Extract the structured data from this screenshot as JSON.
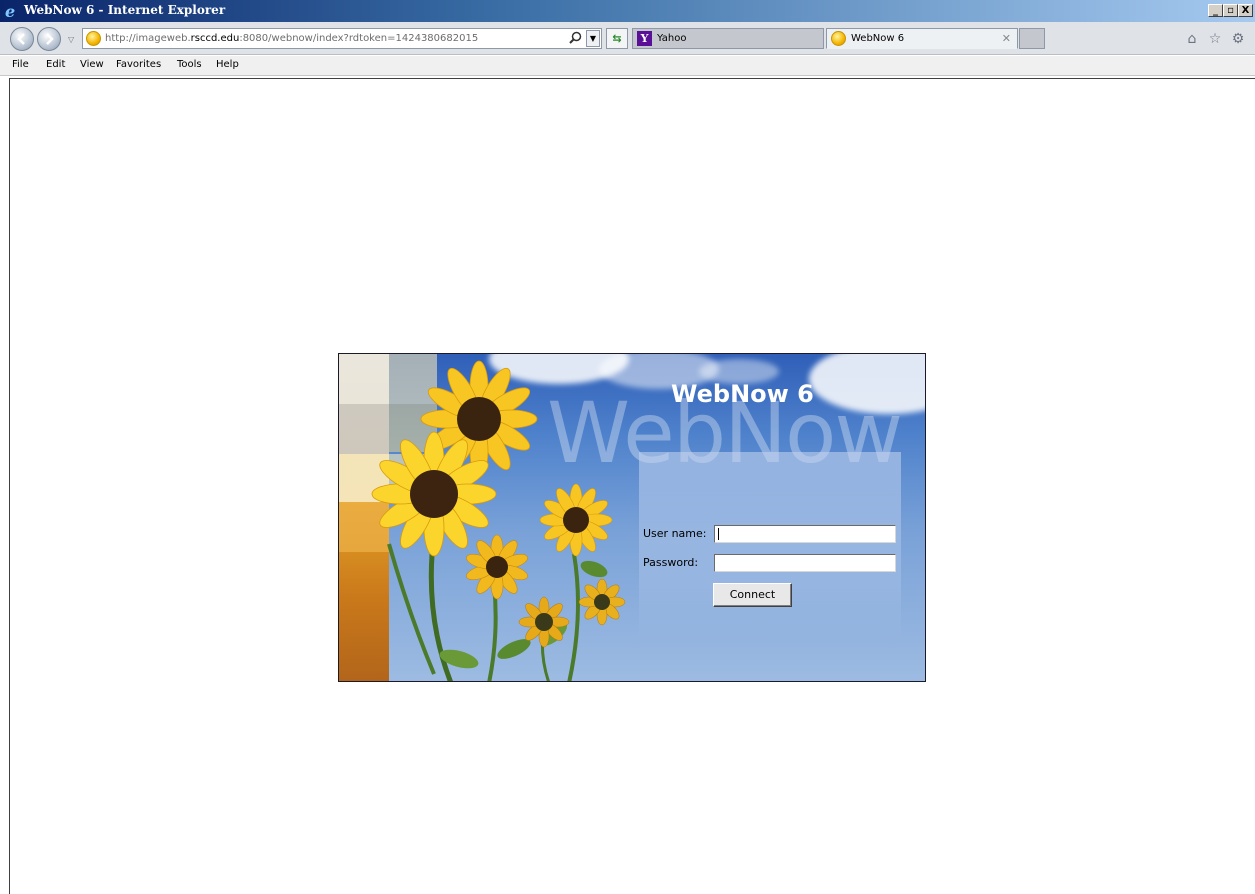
{
  "window": {
    "title": "WebNow 6 - Internet Explorer",
    "minimize": "_",
    "restore": "ɑ",
    "close": "X"
  },
  "address_bar": {
    "url_prefix": "http://imageweb.",
    "url_host": "rsccd.edu",
    "url_suffix": ":8080/webnow/index?rdtoken=1424380682015",
    "search_icon": "search-icon"
  },
  "tabs": [
    {
      "label": "Yahoo",
      "icon": "yahoo-icon",
      "active": false
    },
    {
      "label": "WebNow 6",
      "icon": "webnow-favicon",
      "active": true
    }
  ],
  "toolbar_icons": [
    "home-icon",
    "favorites-star-icon",
    "settings-gear-icon"
  ],
  "menu": [
    {
      "label": "File"
    },
    {
      "label": "Edit"
    },
    {
      "label": "View"
    },
    {
      "label": "Favorites"
    },
    {
      "label": "Tools"
    },
    {
      "label": "Help"
    }
  ],
  "login": {
    "title": "WebNow 6",
    "watermark": "WebNow",
    "username_label": "User name:",
    "username_value": "",
    "password_label": "Password:",
    "password_value": "",
    "connect_label": "Connect"
  }
}
